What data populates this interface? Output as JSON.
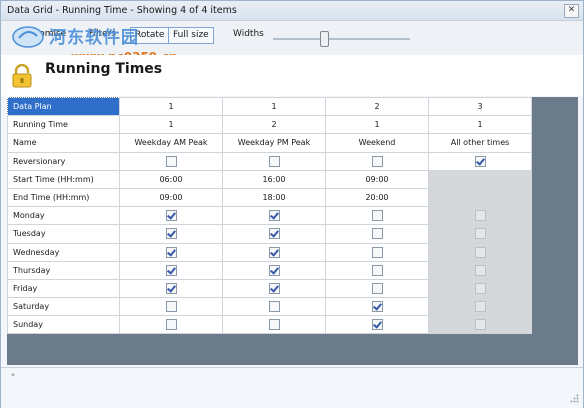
{
  "window": {
    "title": "Data Grid - Running Time - Showing 4 of 4 items",
    "close_label": "✕"
  },
  "toolbar": {
    "customise_label": "Customise",
    "filters_label": "Filters",
    "rotate_label": "Rotate",
    "fullsize_label": "Full size",
    "widths_label": "Widths",
    "widths_slider_level_percent": 37
  },
  "watermark": {
    "cn_text": "河东软件园",
    "url_text": "www.pc0359.cn"
  },
  "header": {
    "title": "Running Times"
  },
  "grid": {
    "rows": [
      {
        "label": "Data Plan",
        "type": "text",
        "values": [
          "1",
          "1",
          "2",
          "3"
        ]
      },
      {
        "label": "Running Time",
        "type": "text",
        "values": [
          "1",
          "2",
          "1",
          "1"
        ]
      },
      {
        "label": "Name",
        "type": "text",
        "values": [
          "Weekday AM Peak",
          "Weekday PM Peak",
          "Weekend",
          "All other times"
        ]
      },
      {
        "label": "Reversionary",
        "type": "check",
        "values": [
          false,
          false,
          false,
          true
        ],
        "disabled": [
          false,
          false,
          false,
          false
        ]
      },
      {
        "label": "Start Time (HH:mm)",
        "type": "text",
        "values": [
          "06:00",
          "16:00",
          "09:00",
          ""
        ],
        "gray": [
          false,
          false,
          false,
          true
        ]
      },
      {
        "label": "End Time (HH:mm)",
        "type": "text",
        "values": [
          "09:00",
          "18:00",
          "20:00",
          ""
        ],
        "gray": [
          false,
          false,
          false,
          true
        ]
      },
      {
        "label": "Monday",
        "type": "check",
        "values": [
          true,
          true,
          false,
          false
        ],
        "disabled": [
          false,
          false,
          false,
          true
        ]
      },
      {
        "label": "Tuesday",
        "type": "check",
        "values": [
          true,
          true,
          false,
          false
        ],
        "disabled": [
          false,
          false,
          false,
          true
        ]
      },
      {
        "label": "Wednesday",
        "type": "check",
        "values": [
          true,
          true,
          false,
          false
        ],
        "disabled": [
          false,
          false,
          false,
          true
        ]
      },
      {
        "label": "Thursday",
        "type": "check",
        "values": [
          true,
          true,
          false,
          false
        ],
        "disabled": [
          false,
          false,
          false,
          true
        ]
      },
      {
        "label": "Friday",
        "type": "check",
        "values": [
          true,
          true,
          false,
          false
        ],
        "disabled": [
          false,
          false,
          false,
          true
        ]
      },
      {
        "label": "Saturday",
        "type": "check",
        "values": [
          false,
          false,
          true,
          false
        ],
        "disabled": [
          false,
          false,
          false,
          true
        ]
      },
      {
        "label": "Sunday",
        "type": "check",
        "values": [
          false,
          false,
          true,
          false
        ],
        "disabled": [
          false,
          false,
          false,
          true
        ]
      }
    ]
  },
  "status": {
    "mark": "\""
  },
  "colors": {
    "selected_row_header": "#2f6fc9",
    "grid_background": "#6c7b89",
    "disabled_cell": "#d5d7da"
  }
}
